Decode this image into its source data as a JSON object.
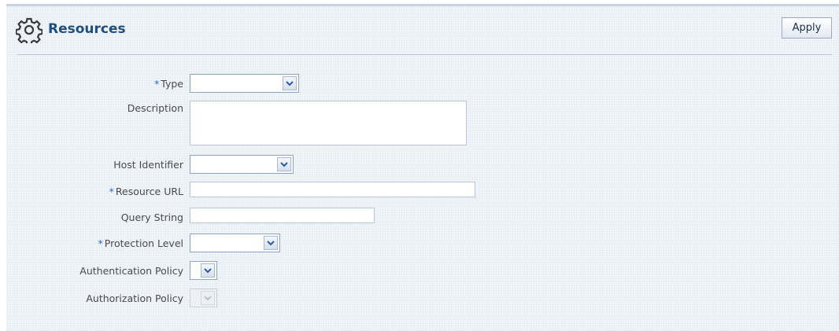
{
  "header": {
    "title": "Resources",
    "icon": "gear-icon",
    "apply_label": "Apply"
  },
  "form": {
    "type": {
      "label": "Type",
      "required": true,
      "value": ""
    },
    "description": {
      "label": "Description",
      "value": ""
    },
    "host_identifier": {
      "label": "Host Identifier",
      "value": ""
    },
    "resource_url": {
      "label": "Resource URL",
      "required": true,
      "value": ""
    },
    "query_string": {
      "label": "Query String",
      "value": ""
    },
    "protection_level": {
      "label": "Protection Level",
      "required": true,
      "value": ""
    },
    "authentication_policy": {
      "label": "Authentication Policy",
      "value": ""
    },
    "authorization_policy": {
      "label": "Authorization Policy",
      "value": "",
      "disabled": true
    }
  },
  "required_marker": "*",
  "colors": {
    "title": "#1f4f7d",
    "required_marker": "#2f66c0",
    "panel_background": "#eef3f8"
  }
}
